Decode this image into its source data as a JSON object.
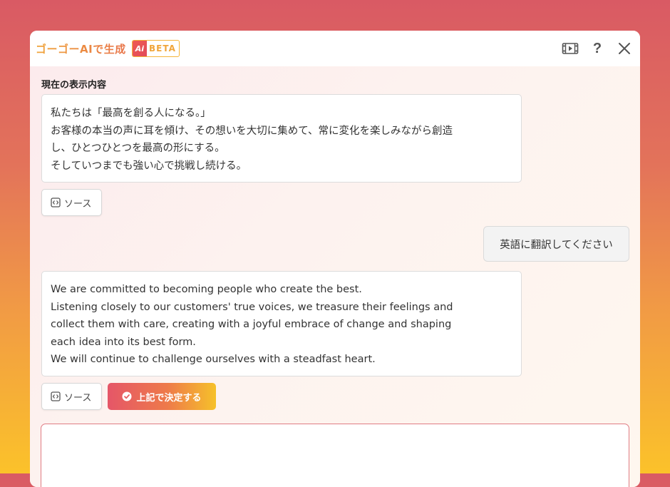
{
  "header": {
    "title": "ゴーゴーAIで生成",
    "ai_mark": "Ai",
    "badge": "BETA",
    "icons": [
      "video-icon",
      "help-icon",
      "close-icon"
    ],
    "help_label": "?"
  },
  "main": {
    "section_label": "現在の表示内容",
    "current_content": [
      "私たちは「最高を創る人になる。」",
      "お客様の本当の声に耳を傾け、その想いを大切に集めて、常に変化を楽しみながら創造",
      "し、ひとつひとつを最高の形にする。",
      "そしていつまでも強い心で挑戦し続ける。"
    ],
    "source_button_label": "ソース",
    "user_message": "英語に翻訳してください",
    "ai_response": [
      "We are committed to becoming people who create the best.",
      "Listening closely to our customers' true voices, we treasure their feelings and",
      "collect them with care, creating with a joyful embrace of change and shaping",
      "each idea into its best form.",
      "We will continue to challenge ourselves with a steadfast heart."
    ],
    "response_source_button_label": "ソース",
    "decide_button_label": "上記で決定する",
    "input_value": "",
    "input_placeholder": ""
  },
  "colors": {
    "accent_red": "#e55668",
    "accent_orange": "#ee7a4a",
    "accent_yellow": "#f6c12a",
    "title_orange": "#f0a53a"
  }
}
